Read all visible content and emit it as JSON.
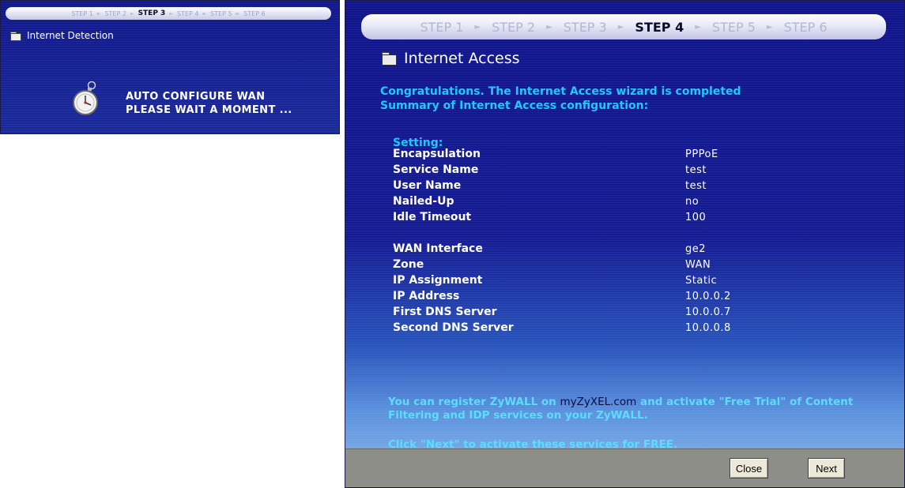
{
  "left_panel": {
    "steps": [
      "STEP 1",
      "STEP 2",
      "STEP 3",
      "STEP 4",
      "STEP 5",
      "STEP 6"
    ],
    "active_step": "STEP 3",
    "section_title": "Internet Detection",
    "message_line1": "AUTO CONFIGURE WAN",
    "message_line2": "PLEASE WAIT A MOMENT ...",
    "icons": {
      "section": "folder-icon",
      "progress": "stopwatch-icon"
    }
  },
  "right_panel": {
    "steps": [
      "STEP 1",
      "STEP 2",
      "STEP 3",
      "STEP 4",
      "STEP 5",
      "STEP 6"
    ],
    "active_step": "STEP 4",
    "title": "Internet Access",
    "congrats_line1": "Congratulations. The Internet Access wizard is completed",
    "congrats_line2": "Summary of Internet Access configuration:",
    "setting_heading": "Setting:",
    "settings_group1": [
      {
        "label": "Encapsulation",
        "value": "PPPoE"
      },
      {
        "label": "Service Name",
        "value": "test"
      },
      {
        "label": "User Name",
        "value": "test"
      },
      {
        "label": "Nailed-Up",
        "value": "no"
      },
      {
        "label": "Idle Timeout",
        "value": "100"
      }
    ],
    "settings_group2": [
      {
        "label": "WAN Interface",
        "value": "ge2"
      },
      {
        "label": "Zone",
        "value": "WAN"
      },
      {
        "label": "IP Assignment",
        "value": "Static"
      },
      {
        "label": "IP Address",
        "value": "10.0.0.2"
      },
      {
        "label": "First DNS Server",
        "value": "10.0.0.7"
      },
      {
        "label": "Second DNS Server",
        "value": "10.0.0.8"
      }
    ],
    "register_prefix": "You can register ZyWALL on ",
    "register_link": "myZyXEL.com",
    "register_suffix": " and activate \"Free Trial\" of Content Filtering and IDP services on your ZyWALL.",
    "click_next": "Click \"Next\" to activate these services for FREE.",
    "buttons": {
      "close": "Close",
      "next": "Next"
    }
  },
  "colors": {
    "panel_blue": "#10148a",
    "highlight_cyan": "#20c8ff",
    "footer_gray": "#8e8e88"
  }
}
